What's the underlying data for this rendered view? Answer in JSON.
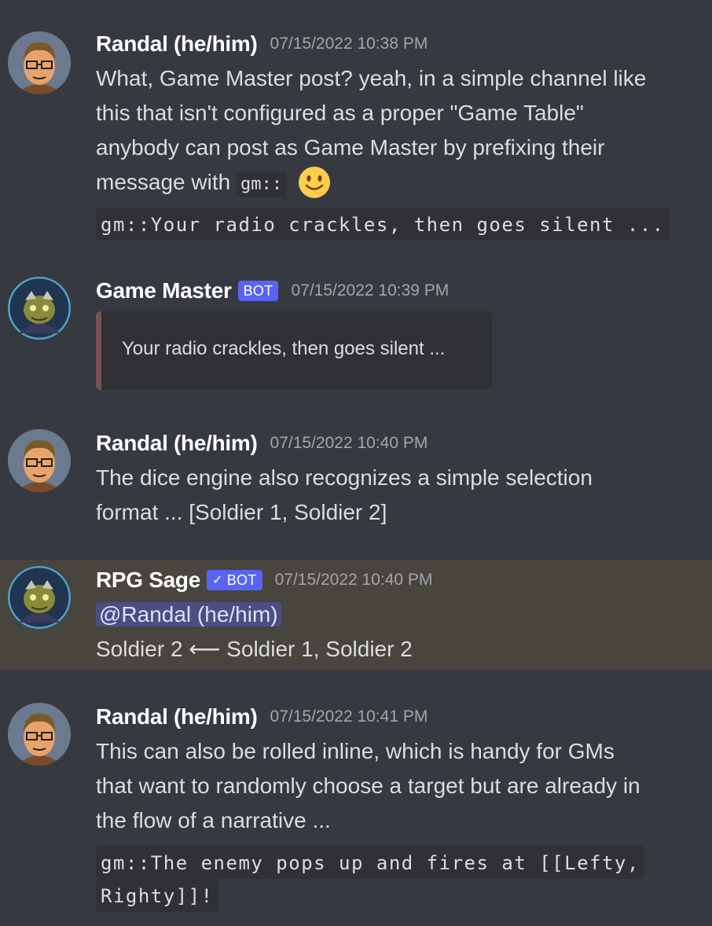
{
  "messages": [
    {
      "author": "Randal (he/him)",
      "timestamp": "07/15/2022 10:38 PM",
      "lines": [
        "What, Game Master post? yeah, in a simple channel like",
        "this that isn't configured as a proper \"Game Table\"",
        "anybody can post as Game Master by prefixing their",
        "message with"
      ],
      "inline_code": "gm::",
      "emoji": "slightly-smiling-face",
      "codeblock": [
        "gm::Your radio crackles, then goes silent ..."
      ]
    },
    {
      "author": "Game Master",
      "badge": "BOT",
      "timestamp": "07/15/2022 10:39 PM",
      "embed_text": "Your radio crackles, then goes silent ..."
    },
    {
      "author": "Randal (he/him)",
      "timestamp": "07/15/2022 10:40 PM",
      "lines": [
        "The dice engine also recognizes a simple selection",
        "format ... [Soldier 1, Soldier 2]"
      ]
    },
    {
      "author": "RPG Sage",
      "badge": "BOT",
      "timestamp": "07/15/2022 10:40 PM",
      "mention": "@Randal (he/him)",
      "result_line": "Soldier 2 ⟵ Soldier 1, Soldier 2",
      "highlight_color": "#48443e"
    },
    {
      "author": "Randal (he/him)",
      "timestamp": "07/15/2022 10:41 PM",
      "lines": [
        "This can also be rolled inline, which is handy for GMs",
        "that want to randomly choose a target but are already in",
        "the flow of a narrative ..."
      ],
      "codeblock": [
        "gm::The enemy pops up and fires at [[Lefty,",
        "Righty]]!"
      ]
    }
  ],
  "colors": {
    "background": "#36393f",
    "badge": "#5865f2",
    "mention": "#4a4f82"
  }
}
